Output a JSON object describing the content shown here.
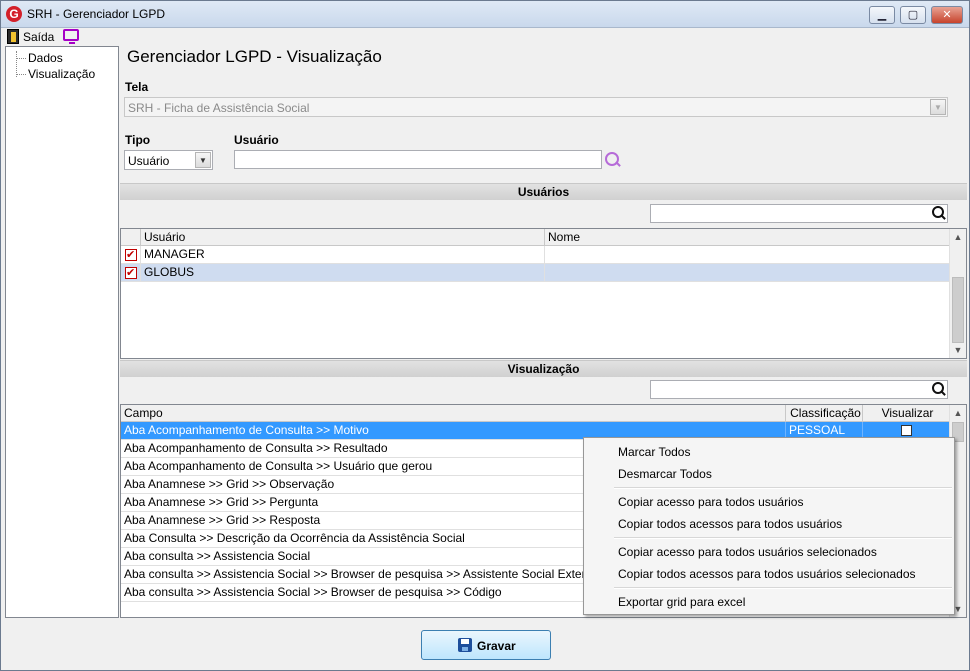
{
  "window": {
    "title": "SRH - Gerenciador LGPD",
    "icon": "globus-logo-icon",
    "accent": "#d3202a"
  },
  "toolbar": {
    "exit_label": "Saída"
  },
  "tree": {
    "items": [
      {
        "label": "Dados"
      },
      {
        "label": "Visualização"
      }
    ]
  },
  "main": {
    "title": "Gerenciador LGPD - Visualização",
    "tela": {
      "label": "Tela",
      "value": "SRH - Ficha de Assistência Social"
    },
    "tipo": {
      "label": "Tipo",
      "value": "Usuário"
    },
    "usuario": {
      "label": "Usuário",
      "value": ""
    }
  },
  "users_section": {
    "title": "Usuários",
    "search_value": "",
    "columns": [
      "Usuário",
      "Nome"
    ],
    "rows": [
      {
        "checked": true,
        "usuario": "MANAGER",
        "nome": ""
      },
      {
        "checked": true,
        "usuario": "GLOBUS",
        "nome": ""
      }
    ]
  },
  "view_section": {
    "title": "Visualização",
    "search_value": "",
    "columns": [
      "Campo",
      "Classificação",
      "Visualizar"
    ],
    "rows": [
      {
        "campo": "Aba Acompanhamento de Consulta >> Motivo",
        "classificacao": "PESSOAL",
        "visualizar": false
      },
      {
        "campo": "Aba Acompanhamento de Consulta >> Resultado",
        "classificacao": "",
        "visualizar": false
      },
      {
        "campo": "Aba Acompanhamento de Consulta >> Usuário que gerou",
        "classificacao": "",
        "visualizar": false
      },
      {
        "campo": "Aba Anamnese >> Grid >> Observação",
        "classificacao": "",
        "visualizar": false
      },
      {
        "campo": "Aba Anamnese >> Grid >> Pergunta",
        "classificacao": "",
        "visualizar": false
      },
      {
        "campo": "Aba Anamnese >> Grid >> Resposta",
        "classificacao": "",
        "visualizar": false
      },
      {
        "campo": "Aba Consulta >>  Descrição da Ocorrência da Assistência Social",
        "classificacao": "",
        "visualizar": false
      },
      {
        "campo": "Aba consulta >> Assistencia Social",
        "classificacao": "",
        "visualizar": false
      },
      {
        "campo": "Aba consulta >> Assistencia Social >> Browser de pesquisa >> Assistente Social Externo",
        "classificacao": "",
        "visualizar": false
      },
      {
        "campo": "Aba consulta >> Assistencia Social >> Browser de pesquisa >> Código",
        "classificacao": "",
        "visualizar": false
      }
    ]
  },
  "context_menu": {
    "items": [
      "Marcar Todos",
      "Desmarcar Todos",
      "Copiar acesso para todos usuários",
      "Copiar todos acessos para todos usuários",
      "Copiar acesso para todos usuários selecionados",
      "Copiar todos acessos para todos usuários selecionados",
      "Exportar grid para excel"
    ]
  },
  "footer": {
    "save_label": "Gravar"
  }
}
